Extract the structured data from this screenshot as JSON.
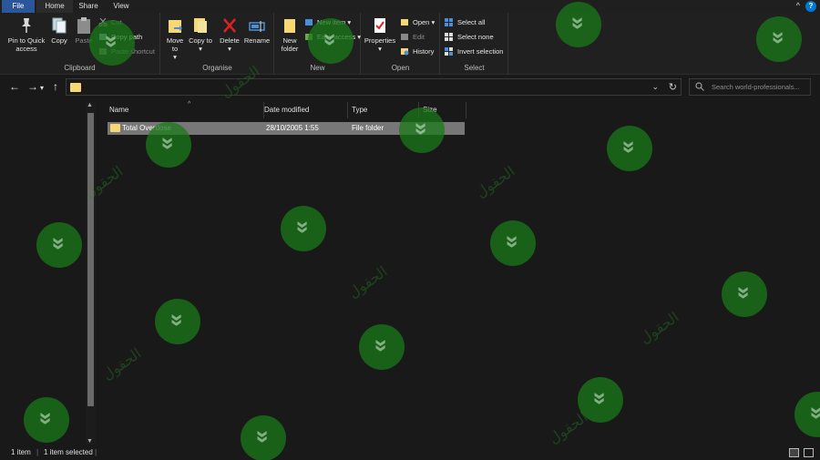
{
  "tabs": {
    "file": "File",
    "home": "Home",
    "share": "Share",
    "view": "View"
  },
  "ribbon": {
    "clipboard": {
      "label": "Clipboard",
      "pin": "Pin to Quick access",
      "copy": "Copy",
      "paste": "Paste",
      "cut": "Cut",
      "copy_path": "Copy path",
      "paste_shortcut": "Paste shortcut"
    },
    "organise": {
      "label": "Organise",
      "move_to": "Move to",
      "copy_to": "Copy to",
      "delete": "Delete",
      "rename": "Rename"
    },
    "new": {
      "label": "New",
      "new_folder": "New folder",
      "new_item": "New item",
      "easy_access": "Easy access"
    },
    "open": {
      "label": "Open",
      "properties": "Properties",
      "open": "Open",
      "edit": "Edit",
      "history": "History"
    },
    "select": {
      "label": "Select",
      "select_all": "Select all",
      "select_none": "Select none",
      "invert_selection": "Invert selection"
    }
  },
  "search": {
    "placeholder": "Search world-professionals..."
  },
  "columns": {
    "name": "Name",
    "date_modified": "Date modified",
    "type": "Type",
    "size": "Size"
  },
  "files": [
    {
      "name": "Total Overdose",
      "date_modified": "28/10/2005 1:55",
      "type": "File folder",
      "size": ""
    }
  ],
  "status": {
    "count": "1 item",
    "selected": "1 item selected"
  },
  "colors": {
    "file_tab": "#2b579a",
    "folder": "#f8d775",
    "watermark": "#1e781e"
  }
}
